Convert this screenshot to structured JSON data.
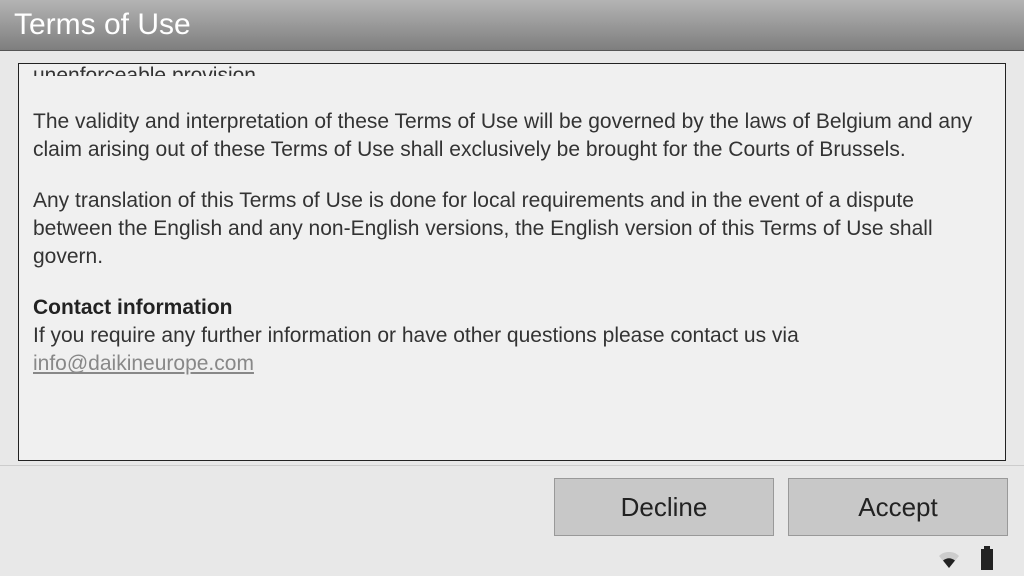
{
  "header": {
    "title": "Terms of Use"
  },
  "body": {
    "truncated_text": "unenforceable provision.",
    "para1": "The validity and interpretation of these Terms of Use will be governed by the laws of Belgium and any claim arising out of these Terms of Use shall exclusively be brought for the Courts of Brussels.",
    "para2": "Any translation of this Terms of Use is done for local requirements and in the event of a dispute between the English and any non-English versions, the English version of this Terms of Use shall govern.",
    "contact_heading": "Contact information",
    "contact_text": "If you require any further information or have other questions please contact us via ",
    "contact_email": "info@daikineurope.com"
  },
  "buttons": {
    "decline": "Decline",
    "accept": "Accept"
  }
}
